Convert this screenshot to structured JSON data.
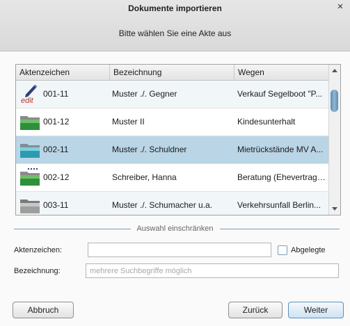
{
  "dialog": {
    "title": "Dokumente importieren",
    "close_glyph": "×",
    "subtitle": "Bitte wählen Sie eine Akte aus"
  },
  "table": {
    "columns": [
      "Aktenzeichen",
      "Bezeichnung",
      "Wegen"
    ],
    "rows": [
      {
        "icon": "edit-document-icon",
        "aktenzeichen": "001-11",
        "bezeichnung": "Muster ./. Gegner",
        "wegen": "Verkauf Segelboot \"P...",
        "selected": false
      },
      {
        "icon": "folder-green-icon",
        "aktenzeichen": "001-12",
        "bezeichnung": "Muster II",
        "wegen": "Kindesunterhalt",
        "selected": false
      },
      {
        "icon": "folder-teal-icon",
        "aktenzeichen": "002-11",
        "bezeichnung": "Muster ./. Schuldner",
        "wegen": "Mietrückstände MV A...",
        "selected": true
      },
      {
        "icon": "folder-green-dotted-icon",
        "aktenzeichen": "002-12",
        "bezeichnung": "Schreiber, Hanna",
        "wegen": "Beratung (Ehevertrag ...",
        "selected": false
      },
      {
        "icon": "folder-grey-icon",
        "aktenzeichen": "003-11",
        "bezeichnung": "Muster ./. Schumacher u.a.",
        "wegen": "Verkehrsunfall Berlin...",
        "selected": false
      }
    ]
  },
  "filter": {
    "section_label": "Auswahl einschränken",
    "aktenzeichen_label": "Aktenzeichen:",
    "aktenzeichen_value": "",
    "abgelegte_label": "Abgelegte",
    "abgelegte_checked": false,
    "bezeichnung_label": "Bezeichnung:",
    "bezeichnung_placeholder": "mehrere Suchbegriffe möglich"
  },
  "buttons": {
    "abbruch": "Abbruch",
    "zurueck": "Zurück",
    "weiter": "Weiter"
  },
  "colors": {
    "selected_row": "#b9d5e6",
    "accent": "#5d8fbd"
  }
}
